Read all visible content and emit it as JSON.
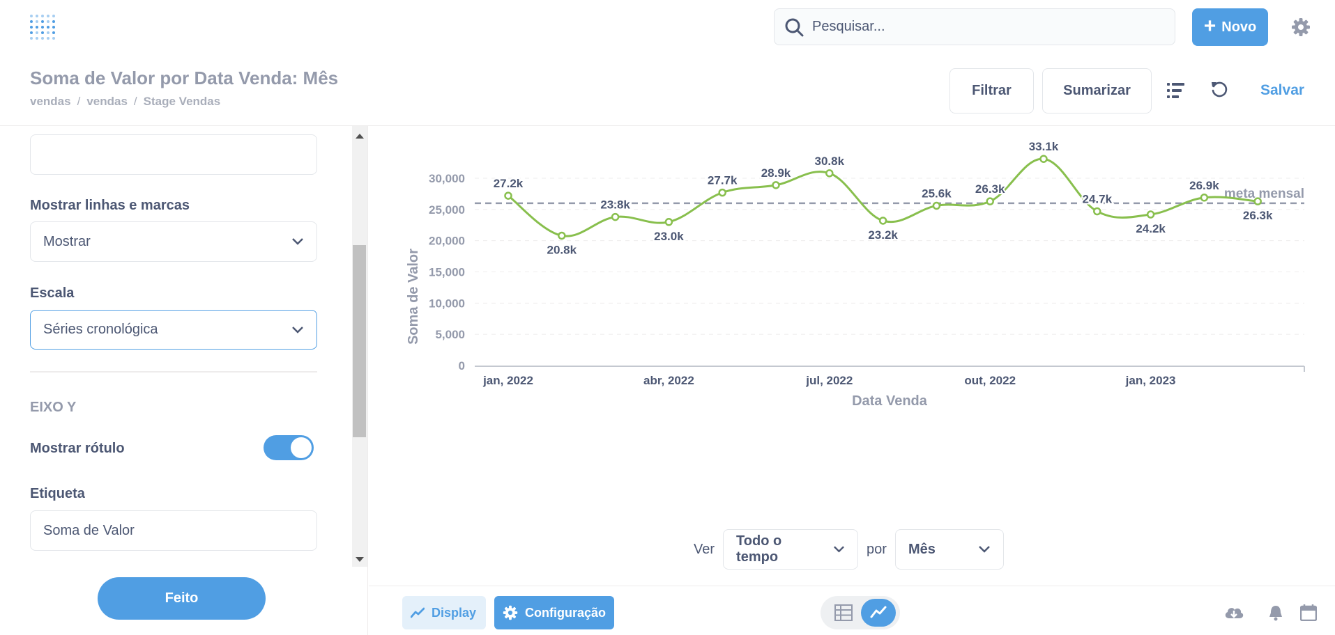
{
  "search": {
    "placeholder": "Pesquisar..."
  },
  "nav": {
    "new_label": "Novo"
  },
  "question": {
    "title": "Soma de Valor por Data Venda: Mês",
    "breadcrumbs": [
      "vendas",
      "vendas",
      "Stage Vendas"
    ],
    "filter_label": "Filtrar",
    "summarize_label": "Sumarizar",
    "save_label": "Salvar"
  },
  "sidebar": {
    "empty_input_value": "",
    "lines_label": "Mostrar linhas e marcas",
    "lines_value": "Mostrar",
    "scale_label": "Escala",
    "scale_value": "Séries cronológica",
    "y_axis_section": "EIXO Y",
    "show_label_label": "Mostrar rótulo",
    "show_label_on": true,
    "etiqueta_label": "Etiqueta",
    "etiqueta_value": "Soma de Valor",
    "done_label": "Feito"
  },
  "time_controls": {
    "ver_label": "Ver",
    "period_value": "Todo o tempo",
    "por_label": "por",
    "granularity_value": "Mês"
  },
  "footer": {
    "display_label": "Display",
    "config_label": "Configuração"
  },
  "colors": {
    "accent": "#509ee3",
    "series": "#88bf4d",
    "goal": "#949aab"
  },
  "chart_data": {
    "type": "line",
    "xlabel": "Data Venda",
    "ylabel": "Soma de Valor",
    "ylim": [
      0,
      30000
    ],
    "y_ticks": [
      "0",
      "5,000",
      "10,000",
      "15,000",
      "20,000",
      "25,000",
      "30,000"
    ],
    "x_ticks": [
      "jan, 2022",
      "abr, 2022",
      "jul, 2022",
      "out, 2022",
      "jan, 2023"
    ],
    "x": [
      "2022-01",
      "2022-02",
      "2022-03",
      "2022-04",
      "2022-05",
      "2022-06",
      "2022-07",
      "2022-08",
      "2022-09",
      "2022-10",
      "2022-11",
      "2022-12",
      "2023-01",
      "2023-02",
      "2023-03"
    ],
    "values": [
      27200,
      20800,
      23800,
      23000,
      27700,
      28900,
      30800,
      23200,
      25600,
      26300,
      33100,
      24700,
      24200,
      26900,
      26300
    ],
    "labels": [
      "27.2k",
      "20.8k",
      "23.8k",
      "23.0k",
      "27.7k",
      "28.9k",
      "30.8k",
      "23.2k",
      "25.6k",
      "26.3k",
      "33.1k",
      "24.7k",
      "24.2k",
      "26.9k",
      "26.3k"
    ],
    "goal": {
      "label": "meta mensal",
      "value": 26000
    },
    "grid": true
  }
}
